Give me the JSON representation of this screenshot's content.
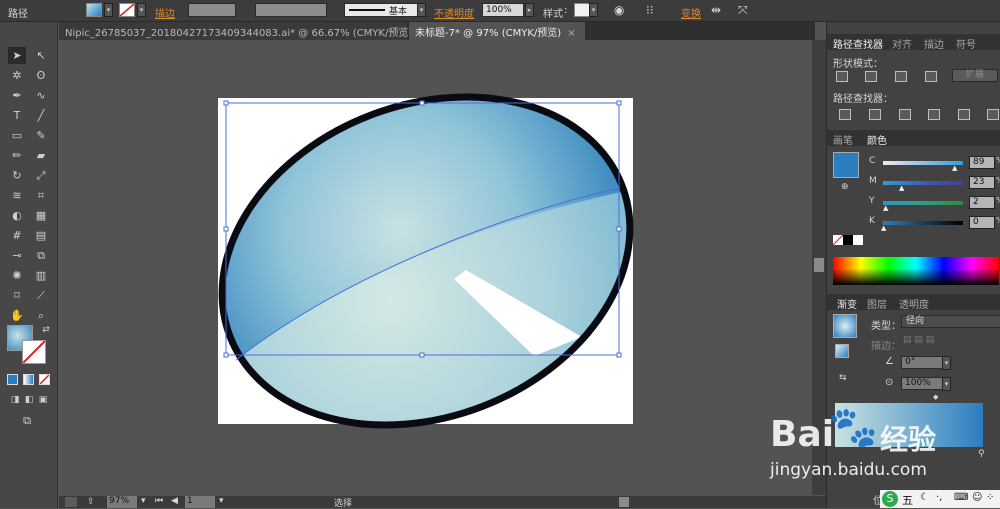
{
  "control_bar": {
    "object_type": "路径",
    "stroke_label": "描边",
    "stroke_style": "基本",
    "opacity_label": "不透明度",
    "opacity_value": "100%",
    "style_label": "样式",
    "transform_label": "变换"
  },
  "doc_tabs": [
    {
      "label": "Nipic_26785037_20180427173409344083.ai* @ 66.67% (CMYK/预览)",
      "close": "×"
    },
    {
      "label": "未标题-7* @ 97% (CMYK/预览)",
      "close": "×"
    }
  ],
  "status_bar": {
    "zoom": "97%",
    "page": "1",
    "tool": "选择"
  },
  "pathfinder_panel": {
    "tabs": [
      "路径查找器",
      "对齐",
      "描边",
      "符号"
    ],
    "shape_modes_label": "形状模式：",
    "expand_label": "扩展",
    "pathfinders_label": "路径查找器："
  },
  "color_panel": {
    "tabs": [
      "画笔",
      "颜色"
    ],
    "channels": [
      {
        "name": "C",
        "value": "89",
        "unit": "%",
        "fraction": 0.89
      },
      {
        "name": "M",
        "value": "23",
        "unit": "%",
        "fraction": 0.23
      },
      {
        "name": "Y",
        "value": "2",
        "unit": "%",
        "fraction": 0.02
      },
      {
        "name": "K",
        "value": "0",
        "unit": "%",
        "fraction": 0.0
      }
    ],
    "swatch_color": "#2b7ec0"
  },
  "gradient_panel": {
    "tabs": [
      "渐变",
      "图层",
      "透明度"
    ],
    "type_label": "类型：",
    "type_value": "径向",
    "stroke_label": "描边：",
    "angle_value": "0°",
    "aspect_value": "100%",
    "location_label": "位"
  },
  "colors": {
    "ellipse_stroke": "#0a0a12",
    "gradient_inner": "#c8e2e2",
    "gradient_outer": "#1f77b8",
    "selection": "#4a6fd8"
  },
  "watermark": {
    "brand": "Bai",
    "brand_end": "经验",
    "url": "jingyan.baidu.com"
  },
  "taskbar": {
    "ime": "五"
  }
}
